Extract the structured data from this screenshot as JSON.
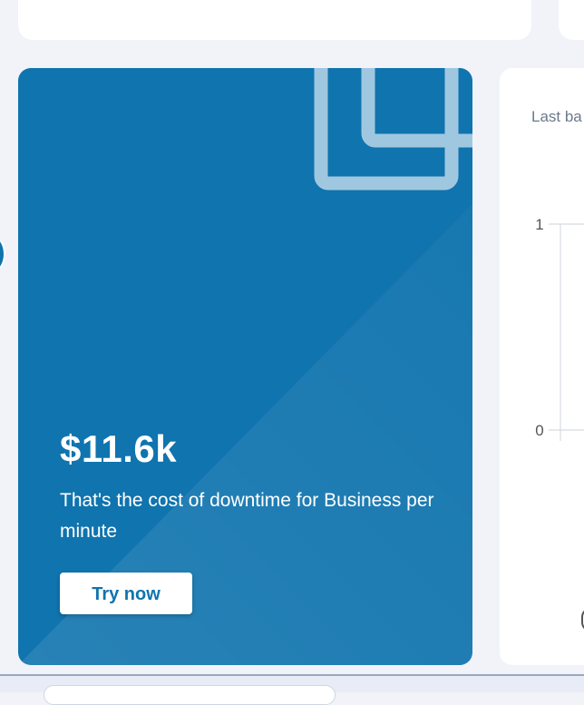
{
  "promo": {
    "amount": "$11.6k",
    "description": "That's the cost of downtime for Business per minute",
    "button_label": "Try now"
  },
  "chart": {
    "title": "Last ba"
  },
  "chart_data": {
    "type": "line",
    "title": "Last ba",
    "y_ticks": [
      "1",
      "0"
    ],
    "ylim": [
      0,
      1
    ],
    "series": []
  },
  "colors": {
    "promo_background": "#1074ae",
    "button_text": "#1074ae",
    "page_background": "#f1f3f8"
  }
}
